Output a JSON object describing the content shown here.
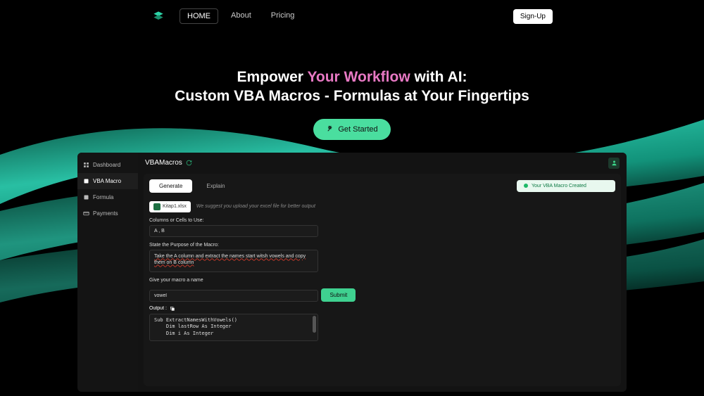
{
  "nav": {
    "links": [
      "HOME",
      "About",
      "Pricing"
    ],
    "signup": "Sign-Up"
  },
  "hero": {
    "line1a": "Empower ",
    "line1b": "Your Workflow",
    "line1c": " with AI:",
    "line2": "Custom VBA Macros - Formulas at Your Fingertips",
    "cta": "Get Started"
  },
  "sidebar": {
    "items": [
      {
        "label": "Dashboard"
      },
      {
        "label": "VBA Macro"
      },
      {
        "label": "Formula"
      },
      {
        "label": "Payments"
      }
    ]
  },
  "main": {
    "title": "VBAMacros",
    "tabs": [
      "Generate",
      "Explain"
    ],
    "toast": "Your VBA Macro Created",
    "file_name": "Kitap1.xlsx",
    "upload_hint": "We suggest you upload your excel file for better output",
    "labels": {
      "columns": "Columns or Cells to Use:",
      "purpose": "State the Purpose of the Macro:",
      "name": "Give your macro a name",
      "output": "Output :"
    },
    "inputs": {
      "columns": "A , B",
      "purpose": "Take the A column and extract the names start witsh vowels and copy them on B column",
      "name": "vowel"
    },
    "submit": "Submit",
    "output_code": "Sub ExtractNamesWithVowels()\n    Dim lastRow As Integer\n    Dim i As Integer"
  }
}
